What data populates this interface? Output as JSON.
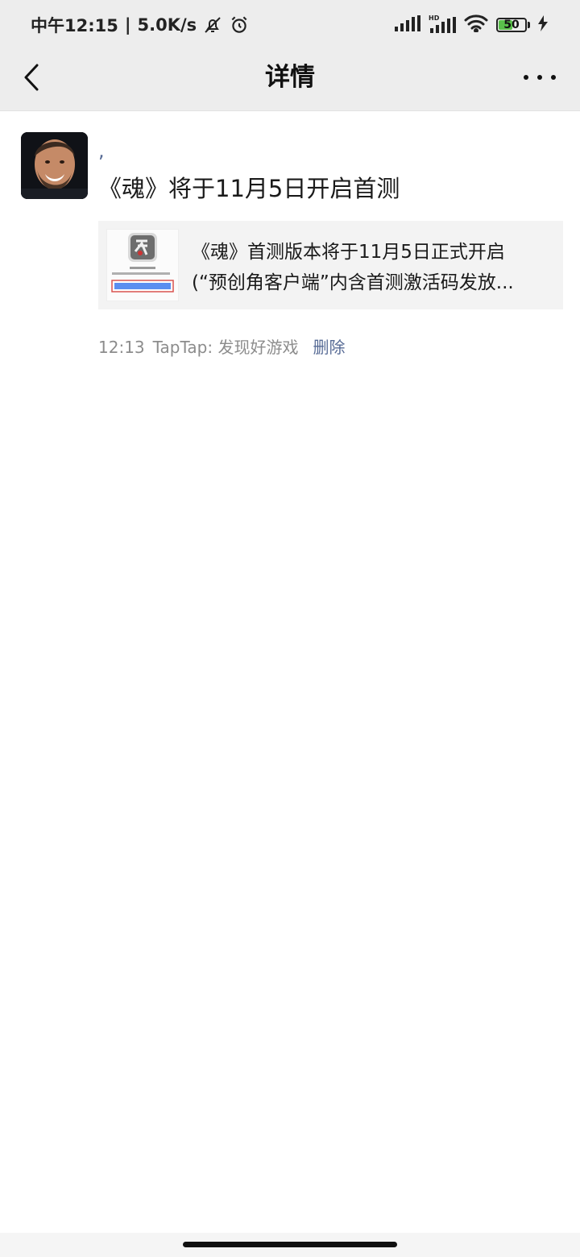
{
  "status_bar": {
    "time": "中午12:15",
    "separator": "|",
    "network_speed": "5.0K/s",
    "battery_level": "50",
    "icons": [
      "bell-off-icon",
      "alarm-icon",
      "signal-icon",
      "hd-signal-icon",
      "wifi-icon",
      "battery-icon",
      "charging-icon"
    ]
  },
  "nav": {
    "title": "详情",
    "back_icon": "chevron-left-icon",
    "more_icon": "more-dots-icon"
  },
  "post": {
    "author": ",",
    "text": "《魂》将于11月5日开启首测",
    "link": {
      "line1": "《魂》首测版本将于11月5日正式开启",
      "line2": "(“预创角客户端”内含首测激活码发放..."
    },
    "time": "12:13",
    "source": "TapTap: 发现好游戏",
    "delete_label": "删除"
  },
  "colors": {
    "header_bg": "#ededed",
    "link_blue": "#576b95",
    "meta_gray": "#8c8c8c",
    "card_bg": "#f3f3f3"
  }
}
